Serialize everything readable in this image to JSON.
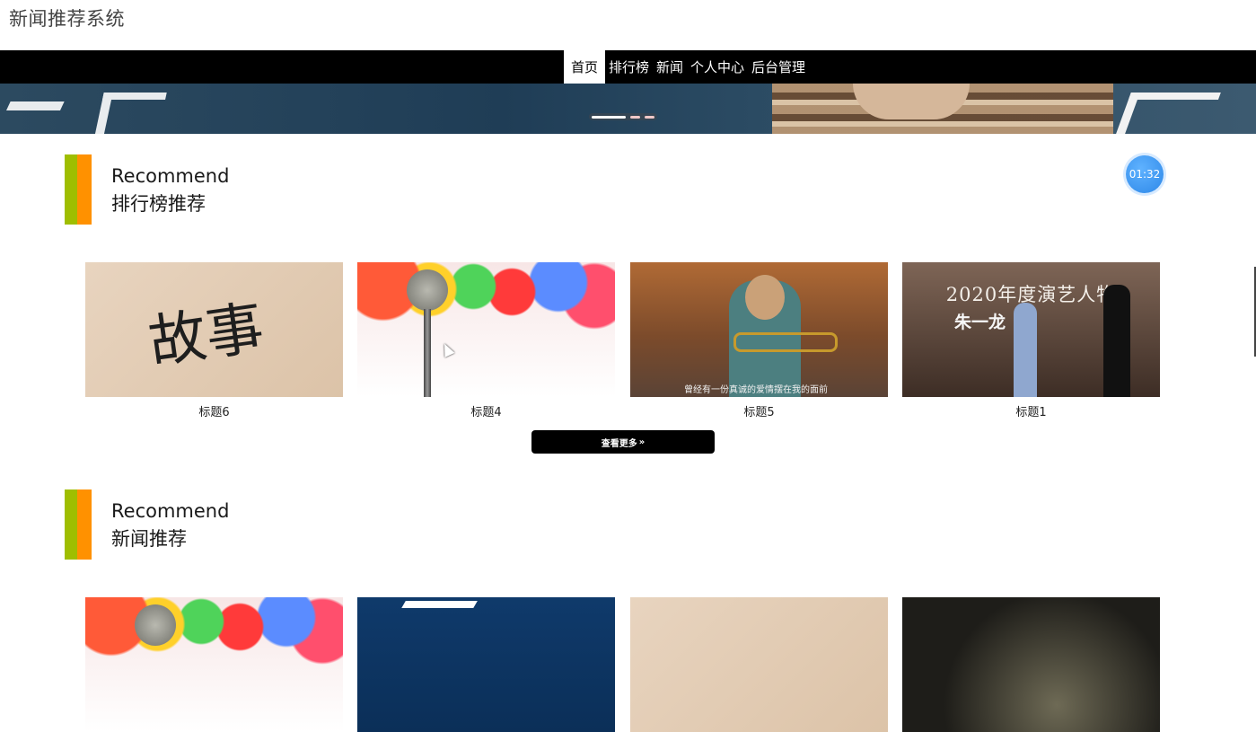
{
  "site": {
    "title": "新闻推荐系统"
  },
  "nav": {
    "items": [
      {
        "label": "首页",
        "active": true
      },
      {
        "label": "排行榜",
        "active": false
      },
      {
        "label": "新闻",
        "active": false
      },
      {
        "label": "个人中心",
        "active": false
      },
      {
        "label": "后台管理",
        "active": false
      }
    ]
  },
  "banner": {
    "slide_count": 3,
    "active_slide": 0
  },
  "timer": {
    "text": "01:32"
  },
  "sections": [
    {
      "title_en": "Recommend",
      "title_cn": "排行榜推荐",
      "cards": [
        {
          "caption": "标题6",
          "image": "calligraphy",
          "image_text": "故事"
        },
        {
          "caption": "标题4",
          "image": "microphone"
        },
        {
          "caption": "标题5",
          "image": "movie-scene",
          "image_text": "曾经有一份真诚的爱情摆在我的面前"
        },
        {
          "caption": "标题1",
          "image": "stage-award",
          "image_text": "2020年度演艺人物",
          "image_text_2": "朱一龙"
        }
      ],
      "more_button": "查看更多"
    },
    {
      "title_en": "Recommend",
      "title_cn": "新闻推荐",
      "cards": [
        {
          "image": "microphone"
        },
        {
          "image": "blue-logo"
        },
        {
          "image": "calligraphy"
        },
        {
          "image": "dark"
        }
      ]
    }
  ],
  "colors": {
    "accent_green": "#9fbe00",
    "accent_orange": "#ff9100",
    "nav_bg": "#000000",
    "timer_blue": "#3a93f0"
  }
}
